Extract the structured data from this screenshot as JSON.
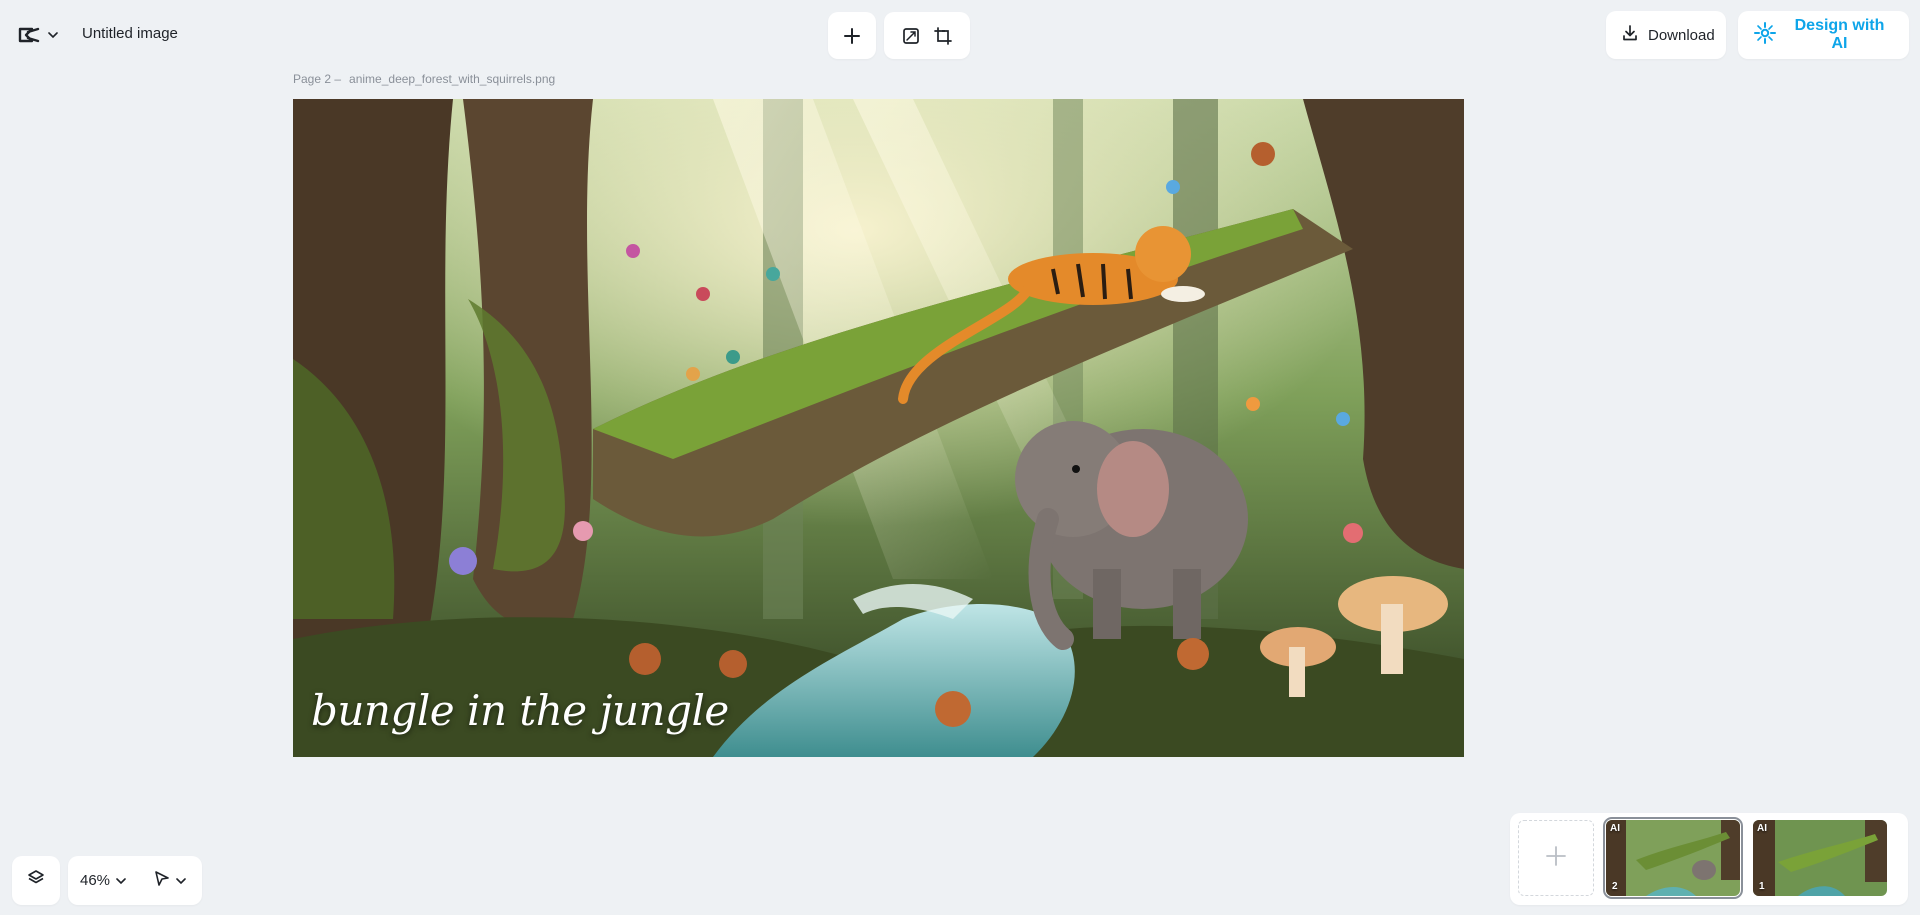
{
  "app": {
    "logo_icon": "capcut-logo-icon",
    "document_title": "Untitled image"
  },
  "toolbar": {
    "add_icon": "plus-icon",
    "resize_icon": "resize-icon",
    "crop_icon": "crop-icon"
  },
  "actions": {
    "download_label": "Download",
    "download_icon": "download-icon",
    "ai_label": "Design with AI",
    "ai_icon": "ai-sparkle-icon",
    "ai_color": "#0ea5e9"
  },
  "page": {
    "label": "Page 2 –",
    "filename": "anime_deep_forest_with_squirrels.png"
  },
  "canvas": {
    "overlay_text": "bungle in the jungle"
  },
  "bottom_controls": {
    "layers_icon": "layers-icon",
    "zoom_level": "46%",
    "pointer_icon": "pointer-icon"
  },
  "pages_panel": {
    "add_page_icon": "plus-icon",
    "thumbnails": [
      {
        "badge": "AI",
        "number": "2",
        "selected": true
      },
      {
        "badge": "AI",
        "number": "1",
        "selected": false
      }
    ]
  }
}
